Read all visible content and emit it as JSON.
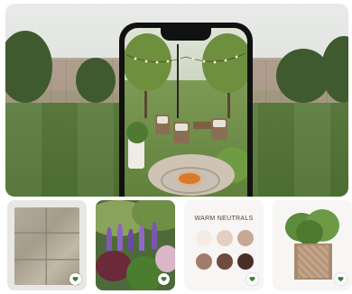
{
  "tiles": [
    {
      "name": "stone-pavers",
      "icon": "heart-icon"
    },
    {
      "name": "flower-garden",
      "icon": "heart-icon"
    },
    {
      "name": "color-palette",
      "icon": "heart-icon",
      "title": "WARM NEUTRALS",
      "swatches": [
        "#f4ece4",
        "#e3cfc2",
        "#c8a797",
        "#a27c6b",
        "#6f4a3f",
        "#4a2f29"
      ]
    },
    {
      "name": "planter-box",
      "icon": "heart-icon"
    }
  ],
  "colors": {
    "heart": "#3f7a3a"
  }
}
